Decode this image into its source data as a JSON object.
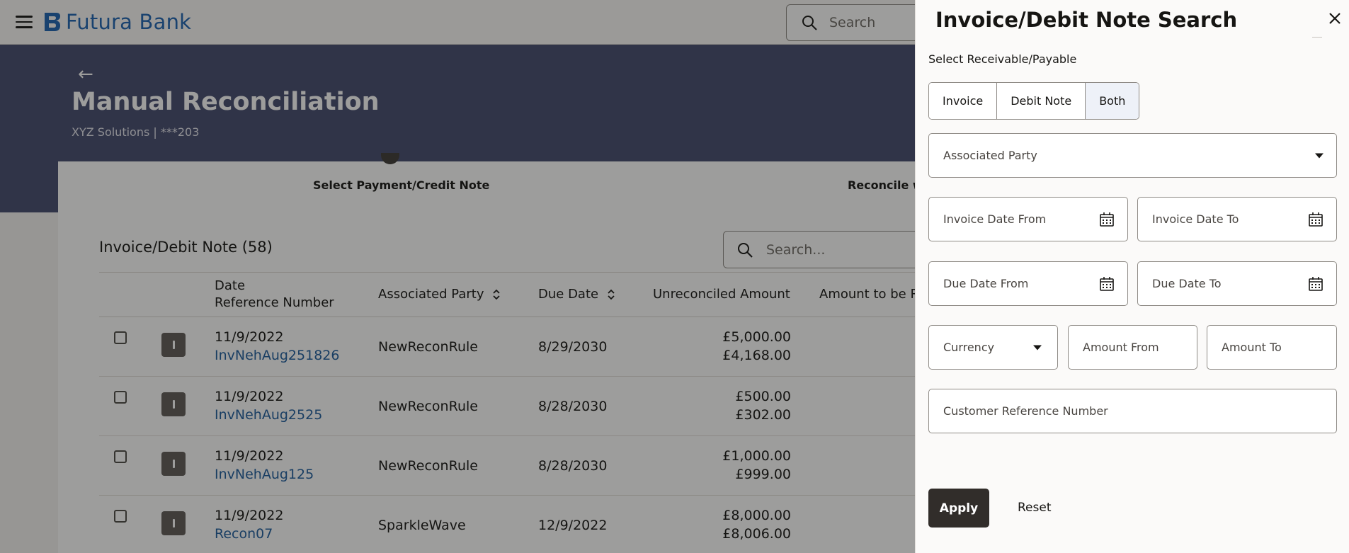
{
  "app": {
    "brand": "Futura Bank",
    "top_search_placeholder": "Search"
  },
  "hero": {
    "title": "Manual Reconciliation",
    "subtitle": "XYZ Solutions | ***203"
  },
  "steps": [
    "Select Payment/Credit Note",
    "Reconcile wi"
  ],
  "list": {
    "title": "Invoice/Debit Note (58)",
    "search_placeholder": "Search...",
    "columns": {
      "date_ref_line1": "Date",
      "date_ref_line2": "Reference Number",
      "associated_party": "Associated Party",
      "due_date": "Due Date",
      "unreconciled_amount": "Unreconciled Amount",
      "amount_to_be": "Amount to be R"
    },
    "rows": [
      {
        "date": "11/9/2022",
        "ref": "InvNehAug251826",
        "party": "NewReconRule",
        "due": "8/29/2030",
        "amount": "£5,000.00",
        "unreconciled": "£4,168.00"
      },
      {
        "date": "11/9/2022",
        "ref": "InvNehAug2525",
        "party": "NewReconRule",
        "due": "8/28/2030",
        "amount": "£500.00",
        "unreconciled": "£302.00"
      },
      {
        "date": "11/9/2022",
        "ref": "InvNehAug125",
        "party": "NewReconRule",
        "due": "8/28/2030",
        "amount": "£1,000.00",
        "unreconciled": "£999.00"
      },
      {
        "date": "11/9/2022",
        "ref": "Recon07",
        "party": "SparkleWave",
        "due": "12/9/2022",
        "amount": "£8,000.00",
        "unreconciled": "£8,006.00"
      }
    ]
  },
  "drawer": {
    "title": "Invoice/Debit Note Search",
    "segment_label": "Select Receivable/Payable",
    "segments": [
      "Invoice",
      "Debit Note",
      "Both"
    ],
    "selected_segment": "Both",
    "fields": {
      "associated_party": "Associated Party",
      "invoice_date_from": "Invoice Date From",
      "invoice_date_to": "Invoice Date To",
      "due_date_from": "Due Date From",
      "due_date_to": "Due Date To",
      "currency": "Currency",
      "amount_from": "Amount From",
      "amount_to": "Amount To",
      "customer_reference_number": "Customer Reference Number"
    },
    "apply_label": "Apply",
    "reset_label": "Reset"
  },
  "colors": {
    "brand": "#1d62b1",
    "hero": "#444a6e",
    "primary_button": "#312d2a",
    "link": "#1d5c9e"
  }
}
